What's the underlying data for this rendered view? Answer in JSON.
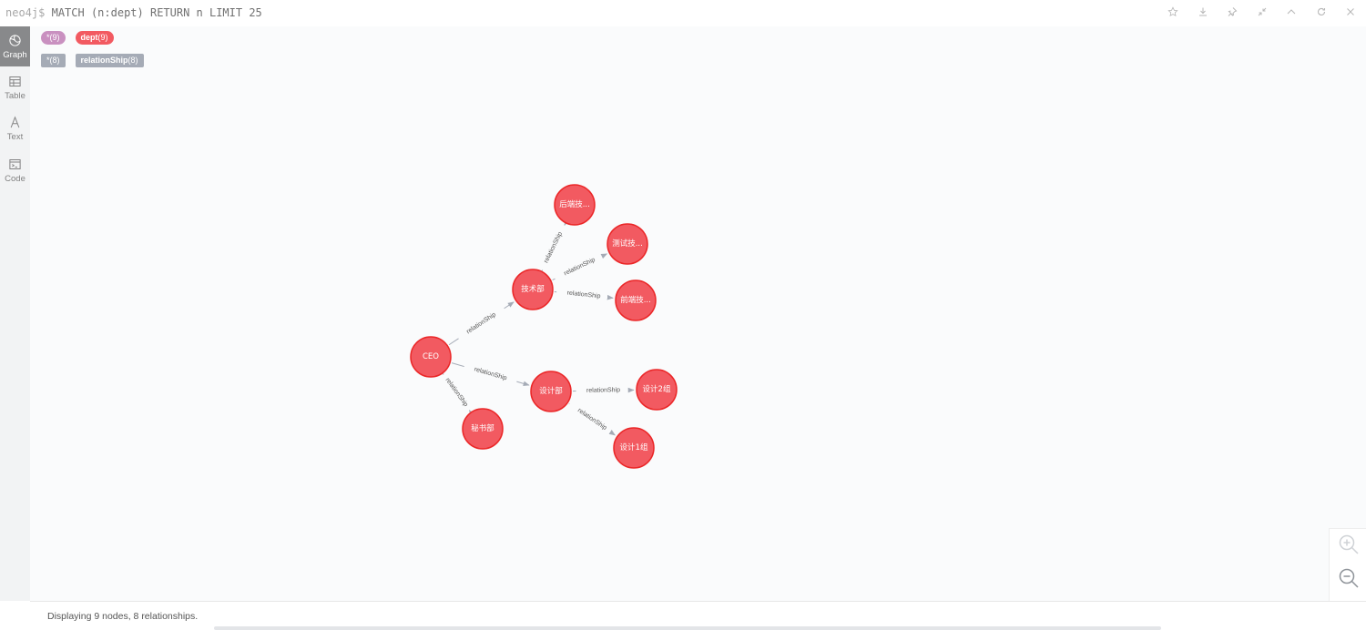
{
  "header": {
    "prompt": "neo4j$",
    "query": "MATCH (n:dept) RETURN n LIMIT 25",
    "actions": [
      {
        "name": "favorite-button",
        "icon": "star-icon"
      },
      {
        "name": "download-button",
        "icon": "download-icon"
      },
      {
        "name": "pin-button",
        "icon": "pin-icon"
      },
      {
        "name": "collapse-button",
        "icon": "compress-icon"
      },
      {
        "name": "fold-button",
        "icon": "chevron-up-icon"
      },
      {
        "name": "rerun-button",
        "icon": "refresh-icon"
      },
      {
        "name": "close-button",
        "icon": "close-icon"
      }
    ]
  },
  "sidebar": {
    "tabs": [
      {
        "label": "Graph",
        "icon": "graph-icon",
        "active": true
      },
      {
        "label": "Table",
        "icon": "table-icon",
        "active": false
      },
      {
        "label": "Text",
        "icon": "text-icon",
        "active": false
      },
      {
        "label": "Code",
        "icon": "code-icon",
        "active": false
      }
    ]
  },
  "legend": {
    "node_labels": [
      {
        "name": "*",
        "count": "(9)",
        "color": "#c990c0"
      },
      {
        "name": "dept",
        "count": "(9)",
        "color": "#f25a61"
      }
    ],
    "relationship_types": [
      {
        "name": "*",
        "count": "(8)",
        "color": "#a5abb6"
      },
      {
        "name": "relationShip",
        "count": "(8)",
        "color": "#a5abb6"
      }
    ]
  },
  "graph": {
    "node_color": "#f25a61",
    "node_border": "#eb2728",
    "edge_color": "#a5abb6",
    "nodes": [
      {
        "id": "ceo",
        "caption": "CEO"
      },
      {
        "id": "tech",
        "caption": "技术部"
      },
      {
        "id": "backend",
        "caption": "后端技..."
      },
      {
        "id": "testing",
        "caption": "测试技..."
      },
      {
        "id": "frontend",
        "caption": "前端技..."
      },
      {
        "id": "design",
        "caption": "设计部"
      },
      {
        "id": "design2",
        "caption": "设计2组"
      },
      {
        "id": "design1",
        "caption": "设计1组"
      },
      {
        "id": "secretary",
        "caption": "秘书部"
      }
    ],
    "edges": [
      {
        "source": "ceo",
        "target": "tech",
        "label": "relationShip"
      },
      {
        "source": "ceo",
        "target": "design",
        "label": "relationShip"
      },
      {
        "source": "ceo",
        "target": "secretary",
        "label": "relationShip"
      },
      {
        "source": "tech",
        "target": "backend",
        "label": "relationShip"
      },
      {
        "source": "tech",
        "target": "testing",
        "label": "relationShip"
      },
      {
        "source": "tech",
        "target": "frontend",
        "label": "relationShip"
      },
      {
        "source": "design",
        "target": "design2",
        "label": "relationShip"
      },
      {
        "source": "design",
        "target": "design1",
        "label": "relationShip"
      }
    ]
  },
  "zoom": {
    "in_icon": "zoom-in-icon",
    "out_icon": "zoom-out-icon"
  },
  "status": {
    "text": "Displaying 9 nodes, 8 relationships."
  }
}
